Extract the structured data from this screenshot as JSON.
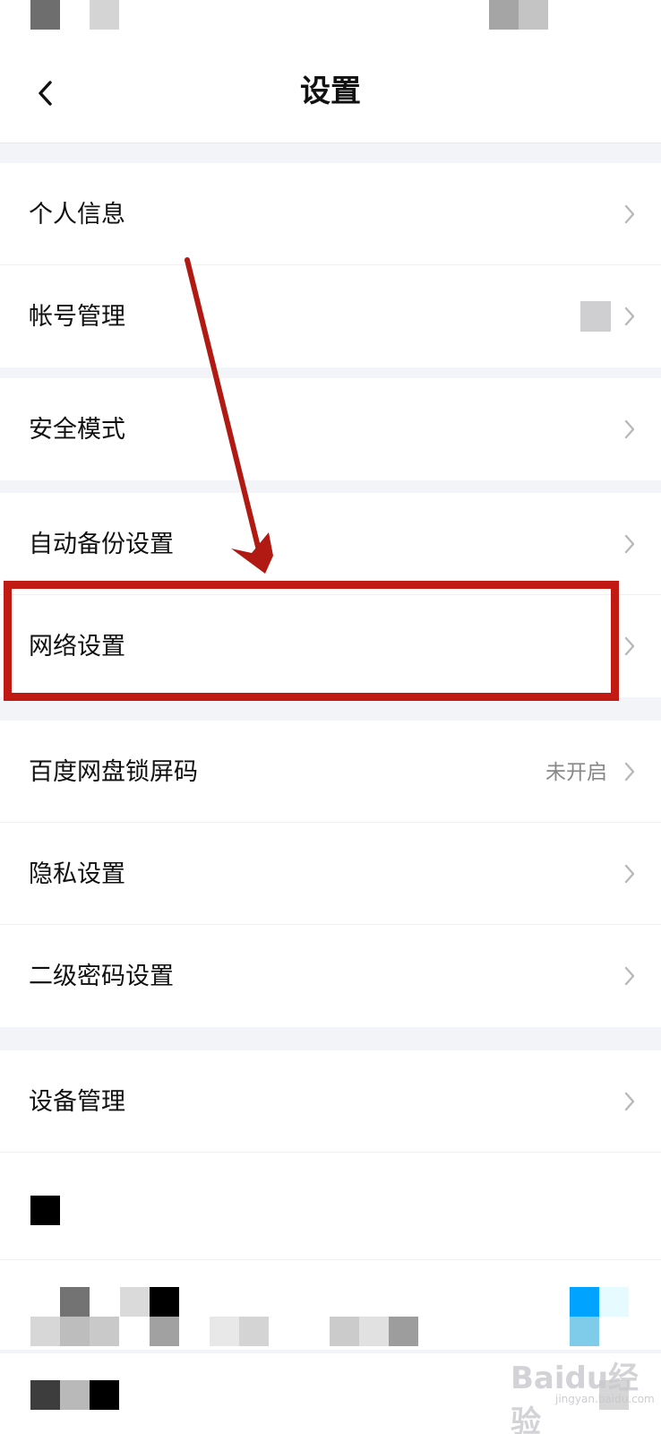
{
  "header": {
    "title": "设置",
    "back_icon": "chevron-left-icon"
  },
  "settings": {
    "personal_info": "个人信息",
    "account_management": "帐号管理",
    "safe_mode": "安全模式",
    "auto_backup": "自动备份设置",
    "network": "网络设置",
    "lock_screen": "百度网盘锁屏码",
    "lock_screen_value": "未开启",
    "privacy": "隐私设置",
    "secondary_password": "二级密码设置",
    "device_management": "设备管理"
  },
  "annotation": {
    "highlight_color": "#c01a12",
    "highlighted_item": "网络设置"
  },
  "watermark": {
    "brand": "Baidu经验",
    "url": "jingyan.baidu.com"
  },
  "colors": {
    "background": "#f3f4f8",
    "text": "#111111",
    "secondary_text": "#888888",
    "chevron": "#b8b8bd"
  }
}
